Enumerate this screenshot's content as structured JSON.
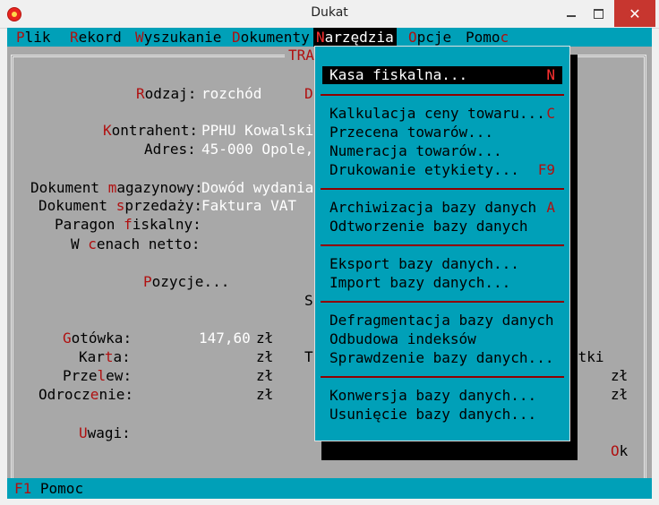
{
  "window": {
    "title": "Dukat"
  },
  "menubar": {
    "items": [
      {
        "hk": "P",
        "rest": "lik"
      },
      {
        "hk": "R",
        "rest": "ekord"
      },
      {
        "hk": "W",
        "rest": "yszukanie"
      },
      {
        "hk": "D",
        "rest": "okumenty"
      },
      {
        "hk": "N",
        "rest": "arzędzia"
      },
      {
        "hk": "O",
        "rest": "pcje"
      },
      {
        "pre": "Pomo",
        "hk": "c",
        "rest": ""
      }
    ]
  },
  "form": {
    "frame_title": "TRA",
    "rodzaj": {
      "hk": "R",
      "rest": "odzaj:",
      "value": "rozchód"
    },
    "d_fragment": "D",
    "kontrahent": {
      "hk": "K",
      "rest": "ontrahent:",
      "value": "PPHU Kowalski"
    },
    "adres": {
      "label": "Adres:",
      "value": "45-000 Opole,"
    },
    "dok_mag": {
      "pre": "Dokument ",
      "hk": "m",
      "rest": "agazynowy:",
      "value": "Dowód wydania"
    },
    "dok_sprz": {
      "pre": "Dokument ",
      "hk": "s",
      "rest": "przedaży:",
      "value": "Faktura VAT"
    },
    "paragon": {
      "pre": "Paragon ",
      "hk": "f",
      "rest": "iskalny:"
    },
    "w_cenach": {
      "pre": "W ",
      "hk": "c",
      "rest": "enach netto:"
    },
    "pozycje": {
      "hk": "P",
      "rest": "ozycje..."
    },
    "s_fragment": "S",
    "t_fragment": "T",
    "etki_fragment": "etki",
    "gotowka": {
      "hk": "G",
      "rest": "otówka:",
      "amount": "147,60",
      "currency": "zł"
    },
    "karta": {
      "pre": "Kar",
      "hk": "t",
      "rest": "a:",
      "currency": "zł"
    },
    "przelew": {
      "pre": "Prze",
      "hk": "l",
      "rest": "ew:",
      "currency": "zł"
    },
    "odroczenie": {
      "pre": "Odrocz",
      "hk": "e",
      "rest": "nie:",
      "currency": "zł"
    },
    "right_zl_1": "zł",
    "right_zl_2": "zł",
    "uwagi": {
      "hk": "U",
      "rest": "wagi:"
    },
    "ok": {
      "hk": "O",
      "rest": "k"
    }
  },
  "dropdown": {
    "items": [
      {
        "label": "Kasa fiskalna...",
        "shortcut": "N"
      },
      {
        "label": "Kalkulacja ceny towaru...",
        "shortcut": "C"
      },
      {
        "label": "Przecena towarów..."
      },
      {
        "label": "Numeracja towarów..."
      },
      {
        "label": "Drukowanie etykiety...",
        "shortcut": "F9"
      },
      {
        "label": "Archiwizacja bazy danych",
        "shortcut": "A"
      },
      {
        "label": "Odtworzenie bazy danych"
      },
      {
        "label": "Eksport bazy danych..."
      },
      {
        "label": "Import bazy danych..."
      },
      {
        "label": "Defragmentacja bazy danych"
      },
      {
        "label": "Odbudowa indeksów"
      },
      {
        "label": "Sprawdzenie bazy danych..."
      },
      {
        "label": "Konwersja bazy danych..."
      },
      {
        "label": "Usunięcie bazy danych..."
      }
    ]
  },
  "statusbar": {
    "key": "F1",
    "label": "Pomoc"
  },
  "colors": {
    "cyan": "#00a0b8",
    "grey": "#a8a8a8",
    "hotkey_red": "#b01010"
  }
}
